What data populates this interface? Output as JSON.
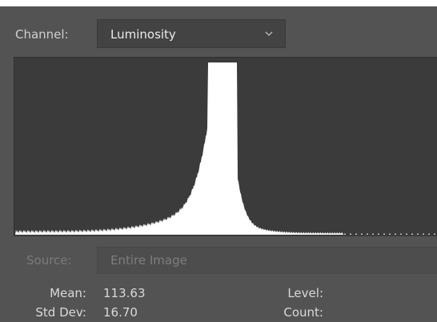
{
  "channel": {
    "label": "Channel:",
    "value": "Luminosity"
  },
  "source": {
    "label": "Source:",
    "value": "Entire Image"
  },
  "stats": {
    "mean_label": "Mean:",
    "mean_value": "113.63",
    "stddev_label": "Std Dev:",
    "stddev_value": "16.70",
    "level_label": "Level:",
    "count_label": "Count:"
  },
  "histogram": {
    "peak_level": 109,
    "peak_clipped": true
  },
  "colors": {
    "panel_bg": "#535353",
    "histogram_bg": "#3b3b3b",
    "histogram_fill": "#ffffff"
  },
  "icons": {
    "channel_dropdown": "chevron-down-icon"
  }
}
